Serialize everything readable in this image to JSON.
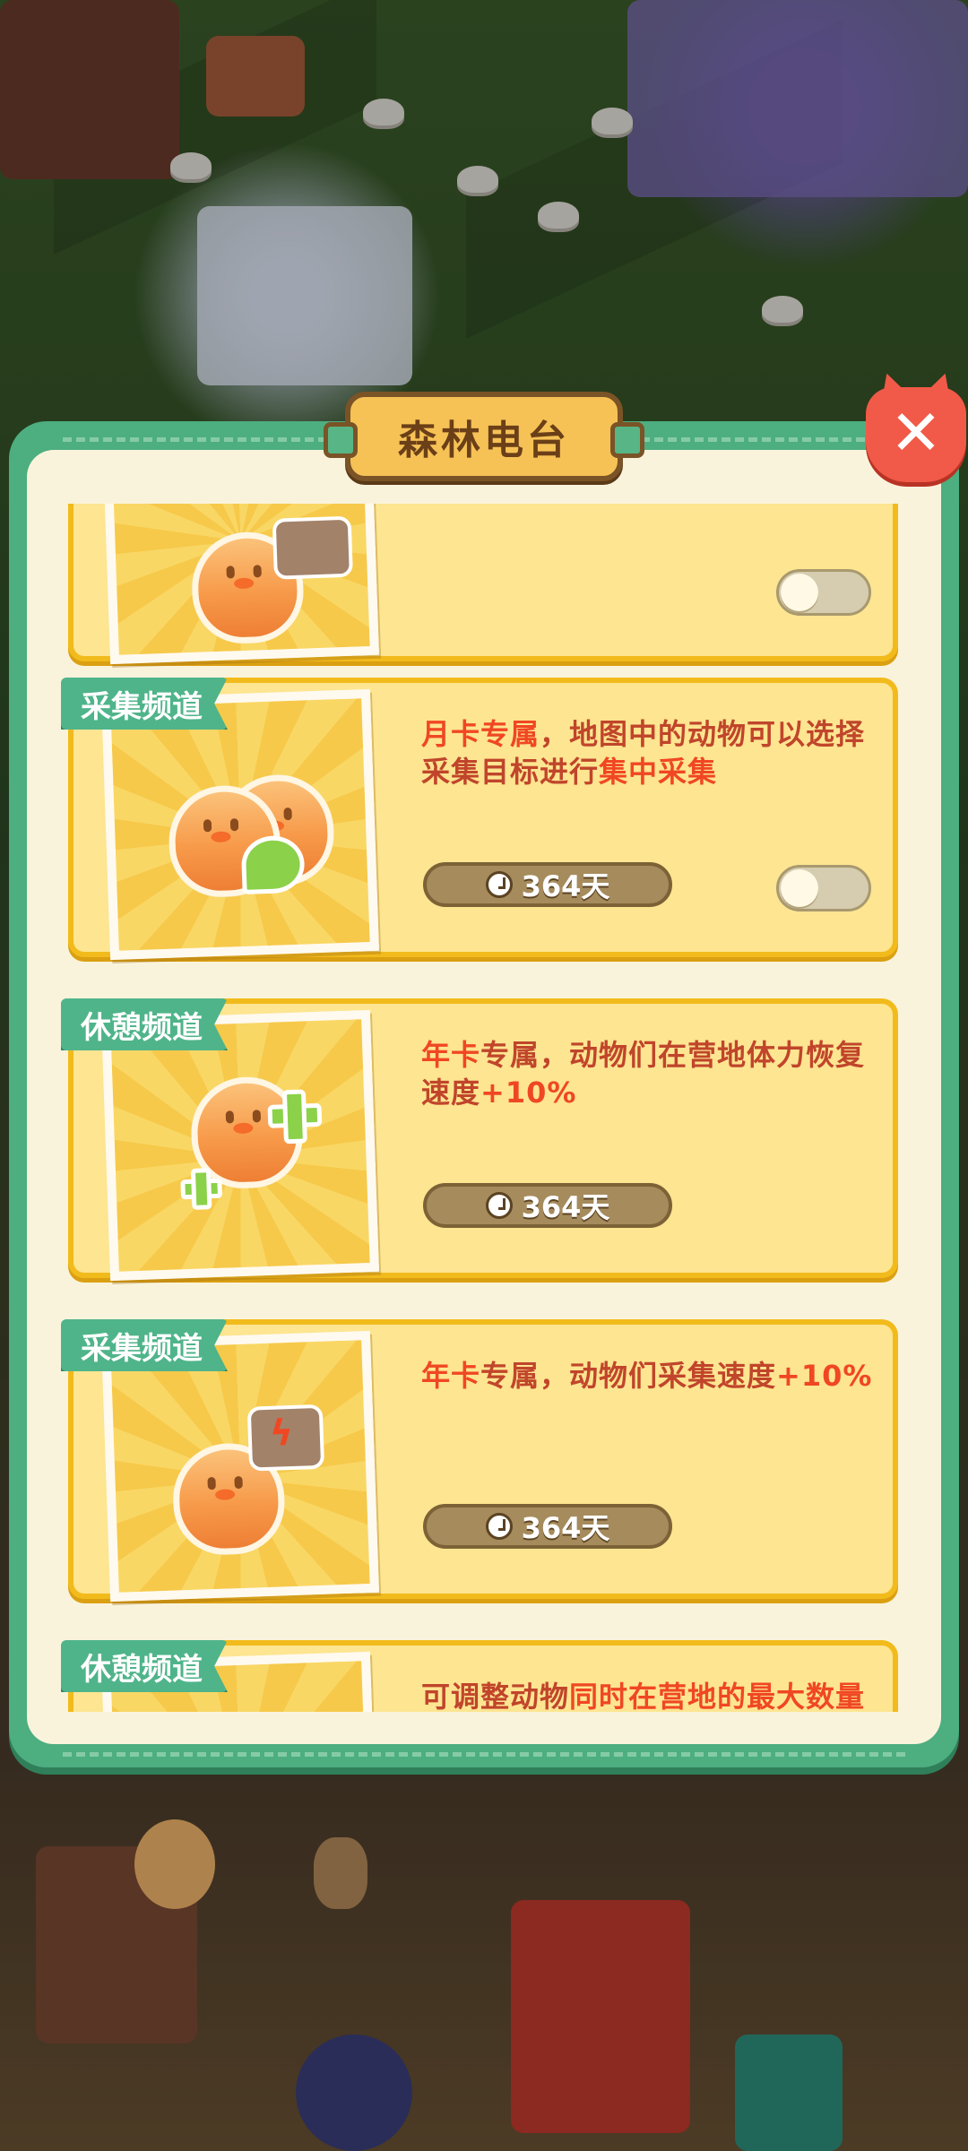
{
  "panel": {
    "title": "森林电台",
    "close_label": "✕"
  },
  "cards": [
    {
      "tag": "",
      "desc_parts": [],
      "timer": "",
      "has_toggle": true,
      "icon": "egg-with-sign-icon"
    },
    {
      "tag": "采集频道",
      "desc_parts": [
        {
          "text": "月卡专属",
          "hl": true
        },
        {
          "text": "，地图中的动物可以选择采集目标进行",
          "hl": false
        },
        {
          "text": "集中采集",
          "hl": true
        }
      ],
      "timer": "364天",
      "has_toggle": true,
      "icon": "two-eggs-clover-icon"
    },
    {
      "tag": "休憩频道",
      "desc_parts": [
        {
          "text": "年卡",
          "hl": true
        },
        {
          "text": "专属，动物们在营地体力恢复速度",
          "hl": false
        },
        {
          "text": "+10%",
          "hl": true
        }
      ],
      "timer": "364天",
      "has_toggle": false,
      "icon": "egg-plus-icon"
    },
    {
      "tag": "采集频道",
      "desc_parts": [
        {
          "text": "年卡",
          "hl": true
        },
        {
          "text": "专属，动物们采集速度",
          "hl": false
        },
        {
          "text": "+10%",
          "hl": true
        }
      ],
      "timer": "364天",
      "has_toggle": false,
      "icon": "egg-lightning-sign-icon"
    },
    {
      "tag": "休憩频道",
      "desc_parts": [
        {
          "text": "可调整动物",
          "hl": false
        },
        {
          "text": "同时在营地的最大数量",
          "hl": true
        }
      ],
      "timer": "",
      "has_toggle": false,
      "icon": "egg-icon"
    }
  ],
  "colors": {
    "panel_green": "#4dae80",
    "card_fill": "#fde591",
    "card_border": "#f2bb1c",
    "highlight_red": "#f04723",
    "text_red": "#c0452b"
  }
}
